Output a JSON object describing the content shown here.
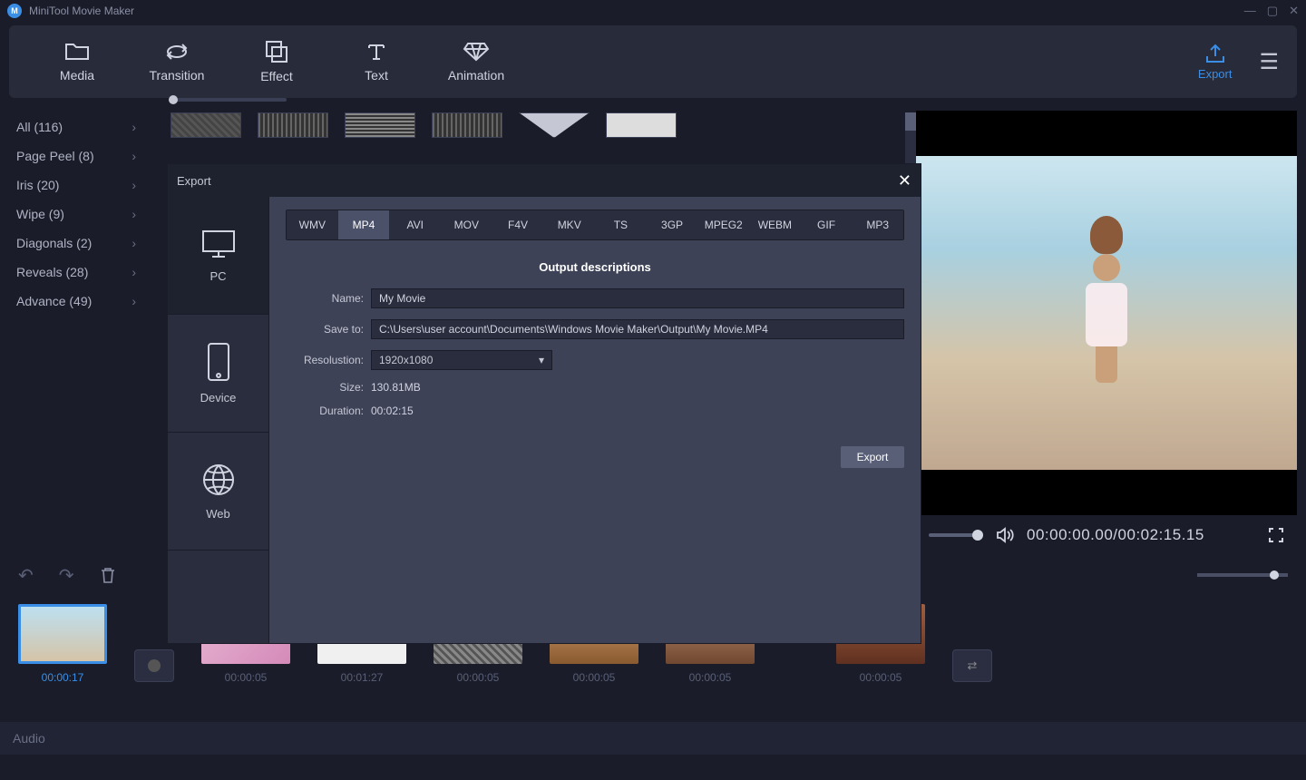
{
  "app": {
    "title": "MiniTool Movie Maker"
  },
  "toolbar": {
    "media": "Media",
    "transition": "Transition",
    "effect": "Effect",
    "text": "Text",
    "animation": "Animation",
    "export": "Export"
  },
  "sidebar": [
    {
      "label": "All (116)"
    },
    {
      "label": "Page Peel (8)"
    },
    {
      "label": "Iris (20)"
    },
    {
      "label": "Wipe (9)"
    },
    {
      "label": "Diagonals (2)"
    },
    {
      "label": "Reveals (28)"
    },
    {
      "label": "Advance (49)"
    }
  ],
  "preview": {
    "time_display": "00:00:00.00/00:02:15.15"
  },
  "timeline": {
    "clips": [
      {
        "time": "00:00:17",
        "selected": true
      },
      {
        "time": "00:00:05"
      },
      {
        "time": "00:01:27"
      },
      {
        "time": "00:00:05"
      },
      {
        "time": "00:00:05"
      },
      {
        "time": "00:00:05"
      }
    ],
    "audio_label": "Audio"
  },
  "dialog": {
    "title": "Export",
    "tabs": [
      {
        "key": "pc",
        "label": "PC",
        "active": true
      },
      {
        "key": "device",
        "label": "Device"
      },
      {
        "key": "web",
        "label": "Web"
      }
    ],
    "formats": [
      "WMV",
      "MP4",
      "AVI",
      "MOV",
      "F4V",
      "MKV",
      "TS",
      "3GP",
      "MPEG2",
      "WEBM",
      "GIF",
      "MP3"
    ],
    "active_format": "MP4",
    "section_title": "Output descriptions",
    "labels": {
      "name": "Name:",
      "save_to": "Save to:",
      "resolution": "Resolustion:",
      "size": "Size:",
      "duration": "Duration:"
    },
    "values": {
      "name": "My Movie",
      "save_to": "C:\\Users\\user account\\Documents\\Windows Movie Maker\\Output\\My Movie.MP4",
      "resolution": "1920x1080",
      "size": "130.81MB",
      "duration": "00:02:15"
    },
    "export_button": "Export"
  }
}
